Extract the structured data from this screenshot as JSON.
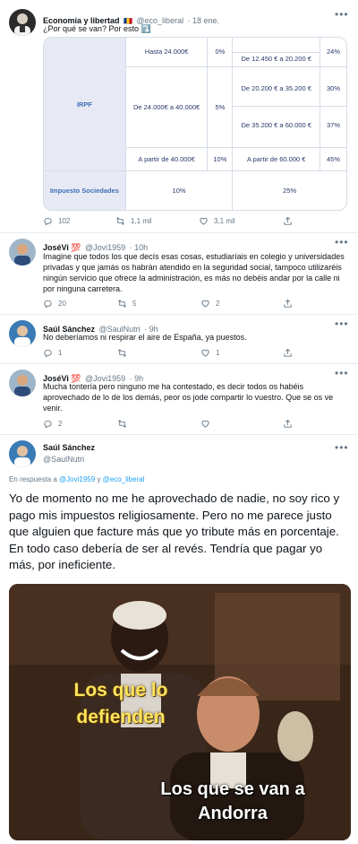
{
  "tweets": [
    {
      "name": "Economía y libertad",
      "flag": "🇷🇴",
      "handle": "@eco_liberal",
      "time": "· 18 ene.",
      "text": "¿Por qué se van? Por esto ⤵️",
      "actions": {
        "reply": "102",
        "retweet": "1,1 mil",
        "like": "3,1 mil"
      }
    },
    {
      "name": "JoséVi 💯",
      "handle": "@Jovi1959",
      "time": "· 10h",
      "text": "Imagine que todos los que decís esas cosas, estudiaríais en colegio y universidades privadas y que jamás os habrán atendido en la seguridad social, tampoco utilizaréis ningún servicio que ofrece la administración, es más no debéis andar por la calle ni por ninguna carretera.",
      "actions": {
        "reply": "20",
        "retweet": "5",
        "like": "2"
      }
    },
    {
      "name": "Saúl Sánchez",
      "handle": "@SaulNutri",
      "time": "· 9h",
      "text": "No deberíamos ni respirar el aire de España, ya puestos.",
      "actions": {
        "reply": "1",
        "retweet": "",
        "like": "1"
      }
    },
    {
      "name": "JoséVi 💯",
      "handle": "@Jovi1959",
      "time": "· 9h",
      "text": "Mucha tontería pero ninguno me ha contestado, es decir todos os habéis aprovechado de lo de los demás, peor os jode compartir lo vuestro. Que se os ve venir.",
      "actions": {
        "reply": "2",
        "retweet": "",
        "like": ""
      }
    }
  ],
  "irpf_table": {
    "irpf_label": "IRPF",
    "row1_range": "Hasta 24.000€",
    "row1_rate": "0%",
    "row1b_range": "De 12.450 € a 20.200 €",
    "row1b_rate": "24%",
    "row2_range": "De 24.000€ a 40.000€",
    "row2_rate": "5%",
    "row2a_range": "De 20.200 € a 35.200 €",
    "row2a_rate": "30%",
    "row2b_range": "De 35.200 € a 60.000 €",
    "row2b_rate": "37%",
    "row3_range": "A partir de 40.000€",
    "row3_rate": "10%",
    "row3b_range": "A partir de 60.000 €",
    "row3b_rate": "45%",
    "soc_label": "Impuesto Sociedades",
    "soc_rate_a": "10%",
    "soc_rate_b": "25%"
  },
  "main_tweet": {
    "name": "Saúl Sánchez",
    "handle": "@SaulNutri",
    "reply_prefix": "En respuesta a",
    "reply_to_1": "@Jovi1959",
    "reply_and": "y",
    "reply_to_2": "@eco_liberal",
    "text": "Yo de momento no me he aprovechado de nadie, no soy rico y pago mis impuestos religiosamente. Pero no me parece justo que alguien que facture más que yo tribute más en porcentaje. En todo caso debería de ser al revés. Tendría que pagar yo más, por ineficiente."
  },
  "meme": {
    "top_text": "Los que lo defienden",
    "bottom_text": "Los que se van a Andorra"
  },
  "icons": {
    "more": "more-icon",
    "reply": "reply-icon",
    "retweet": "retweet-icon",
    "like": "heart-icon",
    "share": "share-icon"
  },
  "colors": {
    "link": "#1da1f2",
    "muted": "#657786",
    "table_header": "#3f6fb5"
  }
}
